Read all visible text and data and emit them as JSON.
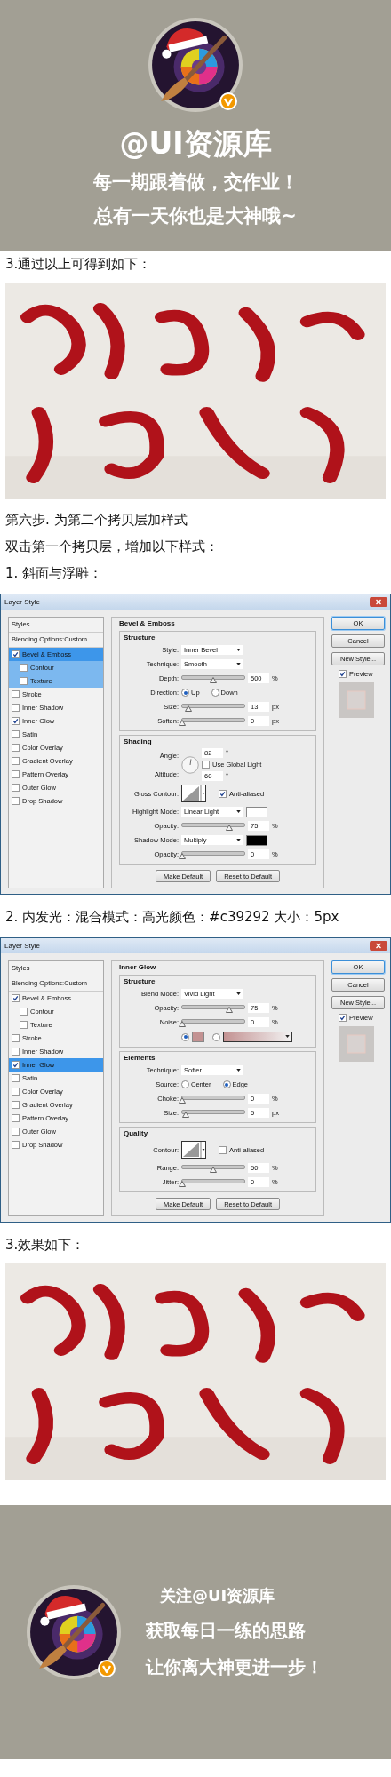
{
  "header": {
    "title": "@UI资源库",
    "lines": [
      "每一期跟着做，交作业！",
      "总有一天你也是大神哦~"
    ]
  },
  "content": [
    {
      "kind": "text",
      "text": "3.通过以上可得到如下："
    },
    {
      "kind": "picture"
    },
    {
      "kind": "text",
      "text": "第六步.  为第二个拷贝层加样式"
    },
    {
      "kind": "text",
      "text": "双击第一个拷贝层，增加以下样式："
    },
    {
      "kind": "text",
      "text": "1.  斜面与浮雕："
    },
    {
      "kind": "dialog",
      "title": "Layer Style",
      "styles_heading": "Styles",
      "blending": "Blending Options:Custom",
      "styles": [
        {
          "label": "Bevel & Emboss",
          "checked": true,
          "selected": true,
          "children": [
            {
              "label": "Contour",
              "checked": false,
              "selected": false
            },
            {
              "label": "Texture",
              "checked": false,
              "selected": false
            }
          ]
        },
        {
          "label": "Stroke",
          "checked": false,
          "selected": false
        },
        {
          "label": "Inner Shadow",
          "checked": false,
          "selected": false
        },
        {
          "label": "Inner Glow",
          "checked": true,
          "selected": false
        },
        {
          "label": "Satin",
          "checked": false,
          "selected": false
        },
        {
          "label": "Color Overlay",
          "checked": false,
          "selected": false
        },
        {
          "label": "Gradient Overlay",
          "checked": false,
          "selected": false
        },
        {
          "label": "Pattern Overlay",
          "checked": false,
          "selected": false
        },
        {
          "label": "Outer Glow",
          "checked": false,
          "selected": false
        },
        {
          "label": "Drop Shadow",
          "checked": false,
          "selected": false
        }
      ],
      "section": "Bevel & Emboss",
      "groups": [
        {
          "title": "Structure",
          "rows": [
            {
              "kind": "dropdown",
              "label": "Style:",
              "value": "Inner Bevel"
            },
            {
              "kind": "dropdown",
              "label": "Technique:",
              "value": "Smooth"
            },
            {
              "kind": "slider",
              "label": "Depth:",
              "level": 0.5,
              "value": "500",
              "unit": "%"
            },
            {
              "kind": "radio",
              "label": "Direction:",
              "options": [
                {
                  "label": "Up",
                  "selected": true
                },
                {
                  "label": "Down",
                  "selected": false
                }
              ]
            },
            {
              "kind": "slider",
              "label": "Size:",
              "level": 0.1,
              "value": "13",
              "unit": "px"
            },
            {
              "kind": "slider",
              "label": "Soften:",
              "level": 0,
              "value": "0",
              "unit": "px"
            }
          ]
        },
        {
          "title": "Shading",
          "rows": [
            {
              "kind": "angle",
              "label": "Angle:",
              "value": "82",
              "unit": "°",
              "check": {
                "label": "Use Global Light",
                "checked": false
              },
              "altitude_label": "Altitude:",
              "altitude_value": "60",
              "altitude_unit": "°"
            },
            {
              "kind": "contour",
              "label": "Gloss Contour:",
              "check": {
                "label": "Anti-aliased",
                "checked": true
              }
            },
            {
              "kind": "dropdown",
              "label": "Highlight Mode:",
              "value": "Linear Light",
              "color": "#ffffff"
            },
            {
              "kind": "slider",
              "label": "Opacity:",
              "level": 0.75,
              "value": "75",
              "unit": "%"
            },
            {
              "kind": "dropdown",
              "label": "Shadow Mode:",
              "value": "Multiply",
              "color": "#000000"
            },
            {
              "kind": "slider",
              "label": "Opacity:",
              "level": 0,
              "value": "0",
              "unit": "%"
            }
          ]
        }
      ],
      "footer_buttons": [
        "Make Default",
        "Reset to Default"
      ],
      "buttons": [
        {
          "label": "OK",
          "default": true
        },
        {
          "label": "Cancel",
          "default": false
        },
        {
          "label": "New Style...",
          "default": false
        }
      ],
      "preview": {
        "label": "Preview",
        "checked": true
      }
    },
    {
      "kind": "text",
      "text": "2.  内发光：混合模式：高光颜色：#c39292 大小：5px"
    },
    {
      "kind": "dialog",
      "title": "Layer Style",
      "styles_heading": "Styles",
      "blending": "Blending Options:Custom",
      "styles": [
        {
          "label": "Bevel & Emboss",
          "checked": true,
          "selected": false,
          "children": [
            {
              "label": "Contour",
              "checked": false,
              "selected": false
            },
            {
              "label": "Texture",
              "checked": false,
              "selected": false
            }
          ]
        },
        {
          "label": "Stroke",
          "checked": false,
          "selected": false
        },
        {
          "label": "Inner Shadow",
          "checked": false,
          "selected": false
        },
        {
          "label": "Inner Glow",
          "checked": true,
          "selected": true
        },
        {
          "label": "Satin",
          "checked": false,
          "selected": false
        },
        {
          "label": "Color Overlay",
          "checked": false,
          "selected": false
        },
        {
          "label": "Gradient Overlay",
          "checked": false,
          "selected": false
        },
        {
          "label": "Pattern Overlay",
          "checked": false,
          "selected": false
        },
        {
          "label": "Outer Glow",
          "checked": false,
          "selected": false
        },
        {
          "label": "Drop Shadow",
          "checked": false,
          "selected": false
        }
      ],
      "section": "Inner Glow",
      "groups": [
        {
          "title": "Structure",
          "rows": [
            {
              "kind": "dropdown",
              "label": "Blend Mode:",
              "value": "Vivid Light"
            },
            {
              "kind": "slider",
              "label": "Opacity:",
              "level": 0.75,
              "value": "75",
              "unit": "%"
            },
            {
              "kind": "slider",
              "label": "Noise:",
              "level": 0,
              "value": "0",
              "unit": "%"
            },
            {
              "kind": "fill",
              "color": "#c39292",
              "options": [
                {
                  "kind": "color",
                  "selected": true
                },
                {
                  "kind": "gradient",
                  "selected": false
                }
              ]
            }
          ]
        },
        {
          "title": "Elements",
          "rows": [
            {
              "kind": "dropdown",
              "label": "Technique:",
              "value": "Softer"
            },
            {
              "kind": "radio",
              "label": "Source:",
              "options": [
                {
                  "label": "Center",
                  "selected": false
                },
                {
                  "label": "Edge",
                  "selected": true
                }
              ]
            },
            {
              "kind": "slider",
              "label": "Choke:",
              "level": 0,
              "value": "0",
              "unit": "%"
            },
            {
              "kind": "slider",
              "label": "Size:",
              "level": 0.05,
              "value": "5",
              "unit": "px"
            }
          ]
        },
        {
          "title": "Quality",
          "rows": [
            {
              "kind": "contour",
              "label": "Contour:",
              "check": {
                "label": "Anti-aliased",
                "checked": false
              }
            },
            {
              "kind": "slider",
              "label": "Range:",
              "level": 0.5,
              "value": "50",
              "unit": "%"
            },
            {
              "kind": "slider",
              "label": "Jitter:",
              "level": 0,
              "value": "0",
              "unit": "%"
            }
          ]
        }
      ],
      "footer_buttons": [
        "Make Default",
        "Reset to Default"
      ],
      "buttons": [
        {
          "label": "OK",
          "default": true
        },
        {
          "label": "Cancel",
          "default": false
        },
        {
          "label": "New Style...",
          "default": false
        }
      ],
      "preview": {
        "label": "Preview",
        "checked": true
      }
    },
    {
      "kind": "text",
      "text": "3.效果如下："
    },
    {
      "kind": "picture"
    }
  ],
  "footer": {
    "lines": [
      "关注@UI资源库",
      "获取每日一练的思路",
      "让你离大神更进一步！"
    ]
  }
}
